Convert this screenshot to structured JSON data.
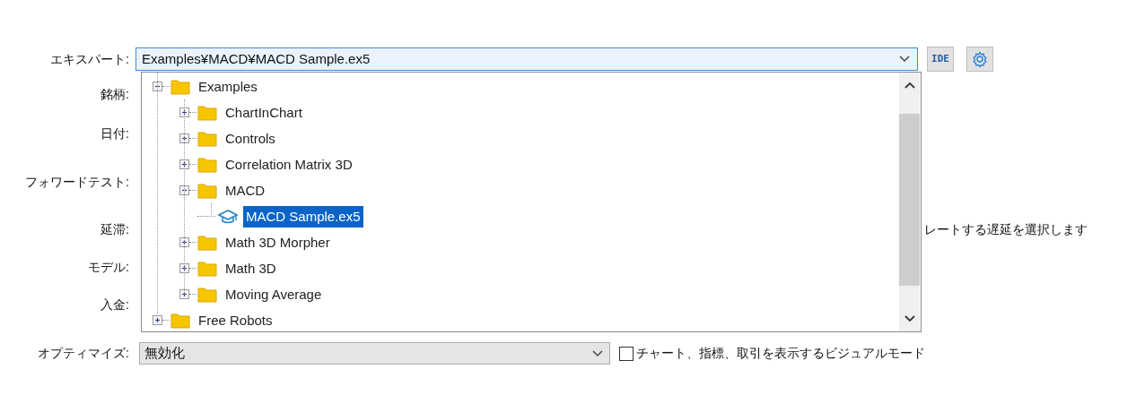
{
  "expert": {
    "label": "エキスパート:",
    "value": "Examples¥MACD¥MACD Sample.ex5"
  },
  "ide_button": "IDE",
  "form_labels": [
    "銘柄:",
    "日付:",
    "フォワードテスト:",
    "延滞:",
    "モデル:",
    "入金:"
  ],
  "delay_hint": "レートする遅延を選択します",
  "tree": [
    {
      "label": "Examples",
      "kind": "folder",
      "expanded": true,
      "selected": false,
      "children": [
        {
          "label": "ChartInChart",
          "kind": "folder",
          "expanded": false,
          "selected": false
        },
        {
          "label": "Controls",
          "kind": "folder",
          "expanded": false,
          "selected": false
        },
        {
          "label": "Correlation Matrix 3D",
          "kind": "folder",
          "expanded": false,
          "selected": false
        },
        {
          "label": "MACD",
          "kind": "folder",
          "expanded": true,
          "selected": false,
          "children": [
            {
              "label": "MACD Sample.ex5",
              "kind": "expert",
              "selected": true
            }
          ]
        },
        {
          "label": "Math 3D Morpher",
          "kind": "folder",
          "expanded": false,
          "selected": false
        },
        {
          "label": "Math 3D",
          "kind": "folder",
          "expanded": false,
          "selected": false
        },
        {
          "label": "Moving Average",
          "kind": "folder",
          "expanded": false,
          "selected": false
        }
      ]
    },
    {
      "label": "Free Robots",
      "kind": "folder",
      "expanded": false,
      "selected": false
    }
  ],
  "optimize": {
    "label": "オプティマイズ:",
    "value": "無効化"
  },
  "visual_mode": {
    "label": "チャート、指標、取引を表示するビジュアルモード",
    "checked": false
  }
}
